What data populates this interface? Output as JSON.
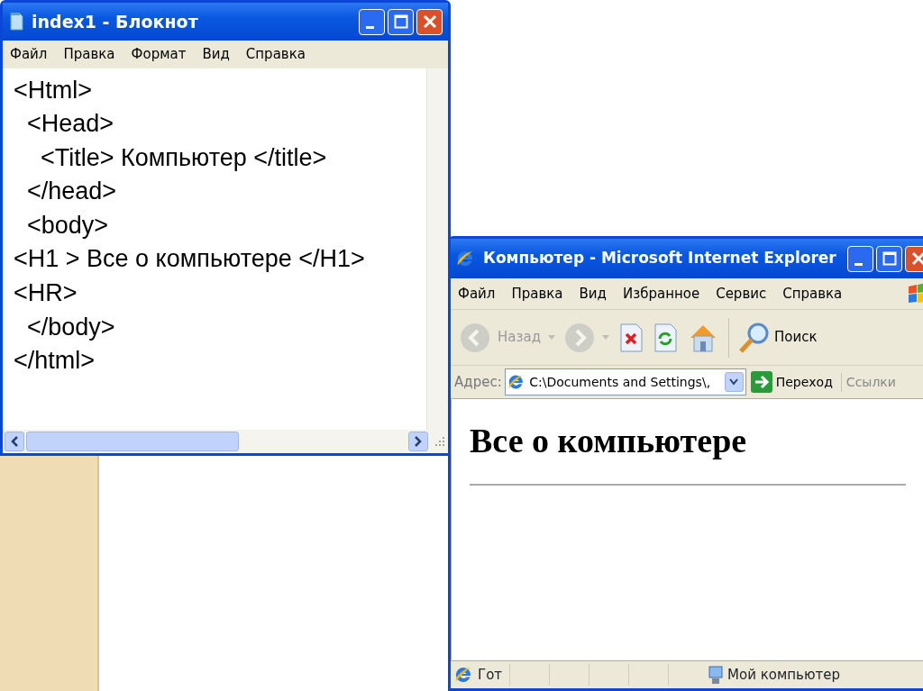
{
  "notepad": {
    "title": "index1 - Блокнот",
    "menu": [
      "Файл",
      "Правка",
      "Формат",
      "Вид",
      "Справка"
    ],
    "lines": [
      "<Html>",
      "  <Head>",
      "    <Title> Компьютер </title>",
      "  </head>",
      "  <body>",
      "<H1 > Все о компьютере </H1>",
      "<HR>",
      "  </body>",
      "</html>"
    ]
  },
  "browser": {
    "title": "Компьютер - Microsoft Internet Explorer",
    "menu": [
      "Файл",
      "Правка",
      "Вид",
      "Избранное",
      "Сервис",
      "Справка"
    ],
    "toolbar": [
      {
        "kind": "back",
        "label": "Назад",
        "disabled": true
      },
      {
        "kind": "forward",
        "disabled": true
      },
      {
        "kind": "stop",
        "disabled": false
      },
      {
        "kind": "refresh",
        "disabled": false
      },
      {
        "kind": "home",
        "disabled": false
      },
      {
        "kind": "search",
        "label": "Поиск",
        "disabled": false
      }
    ],
    "address": {
      "label": "Адрес:",
      "value": "C:\\Documents and Settings\\,",
      "go": "Переход",
      "links": "Ссылки"
    },
    "page": {
      "heading": "Все о компьютере"
    },
    "status": {
      "text": "Гот",
      "zone": "Мой компьютер"
    }
  }
}
